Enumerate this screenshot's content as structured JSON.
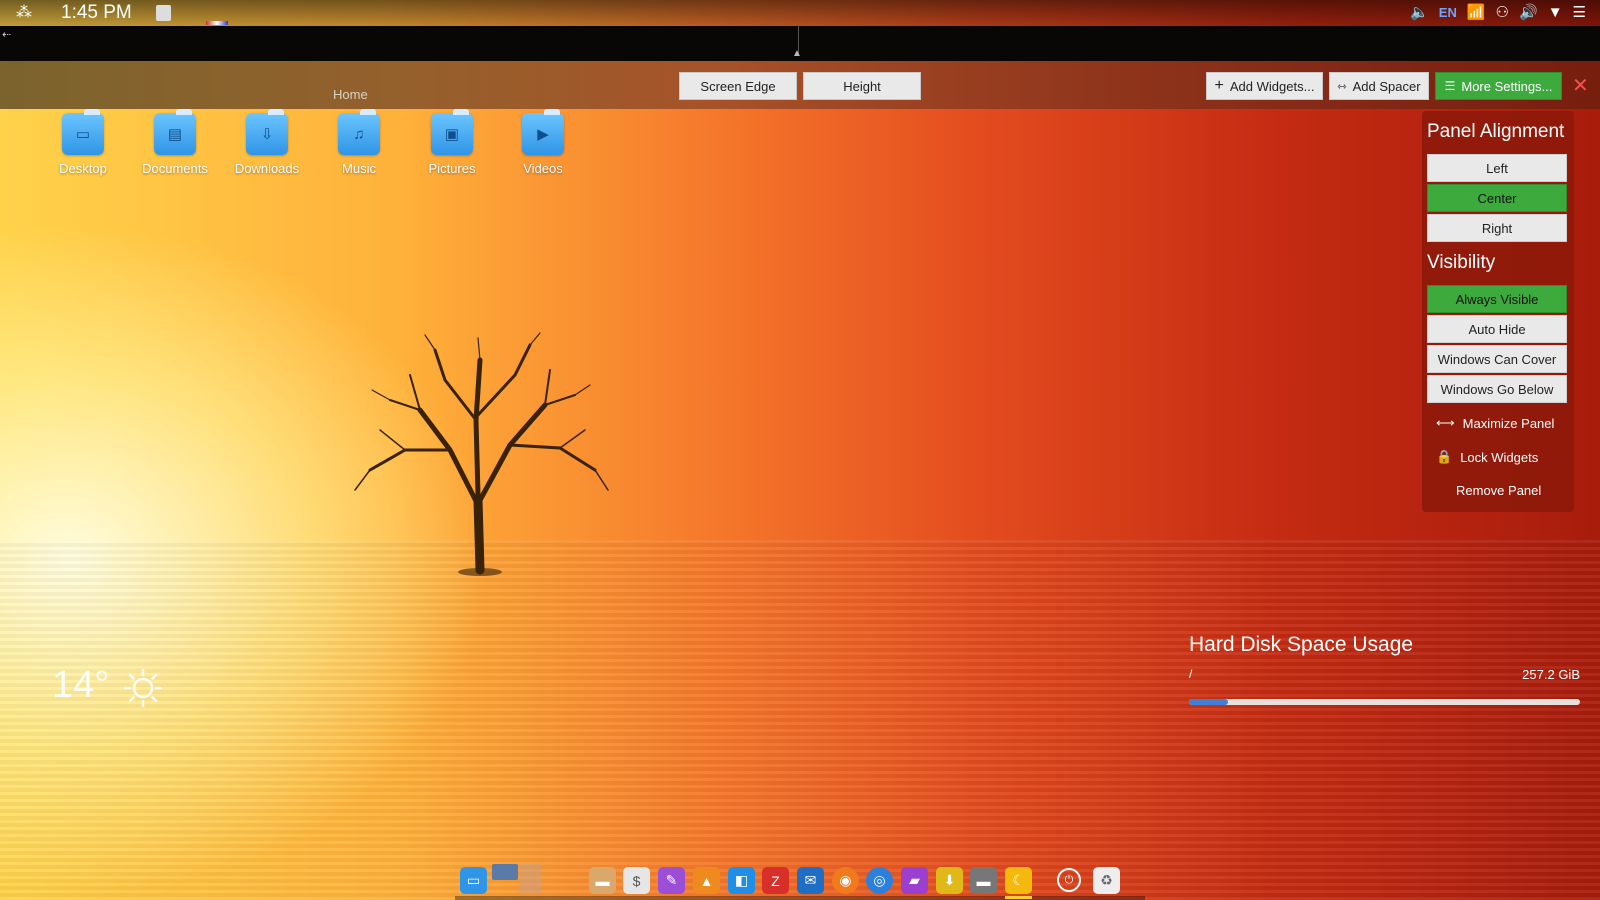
{
  "topbar": {
    "clock": "1:45 PM",
    "language": "EN"
  },
  "toolbar": {
    "home_label": "Home",
    "screen_edge": "Screen Edge",
    "height": "Height",
    "add_widgets": "Add Widgets...",
    "add_spacer": "Add Spacer",
    "more_settings": "More Settings...",
    "close": "✕"
  },
  "desktop": {
    "folders": [
      {
        "label": "Desktop",
        "icon": "desktop-folder-icon",
        "glyph": "▭"
      },
      {
        "label": "Documents",
        "icon": "documents-folder-icon",
        "glyph": "▤"
      },
      {
        "label": "Downloads",
        "icon": "downloads-folder-icon",
        "glyph": "⇩"
      },
      {
        "label": "Music",
        "icon": "music-folder-icon",
        "glyph": "♫"
      },
      {
        "label": "Pictures",
        "icon": "pictures-folder-icon",
        "glyph": "▣"
      },
      {
        "label": "Videos",
        "icon": "videos-folder-icon",
        "glyph": "▶"
      }
    ]
  },
  "settings": {
    "alignment_heading": "Panel Alignment",
    "align_left": "Left",
    "align_center": "Center",
    "align_right": "Right",
    "visibility_heading": "Visibility",
    "always_visible": "Always Visible",
    "auto_hide": "Auto Hide",
    "windows_can_cover": "Windows Can Cover",
    "windows_go_below": "Windows Go Below",
    "maximize_panel": "Maximize Panel",
    "lock_widgets": "Lock Widgets",
    "remove_panel": "Remove Panel"
  },
  "weather": {
    "temperature": "14°"
  },
  "disk": {
    "title": "Hard Disk Space Usage",
    "mount": "/",
    "size": "257.2 GiB",
    "usage_fraction": 0.1
  },
  "colors": {
    "accent_green": "#3daa3d",
    "close_red": "#ff4c4c",
    "disk_bar": "#3f7fd6"
  }
}
